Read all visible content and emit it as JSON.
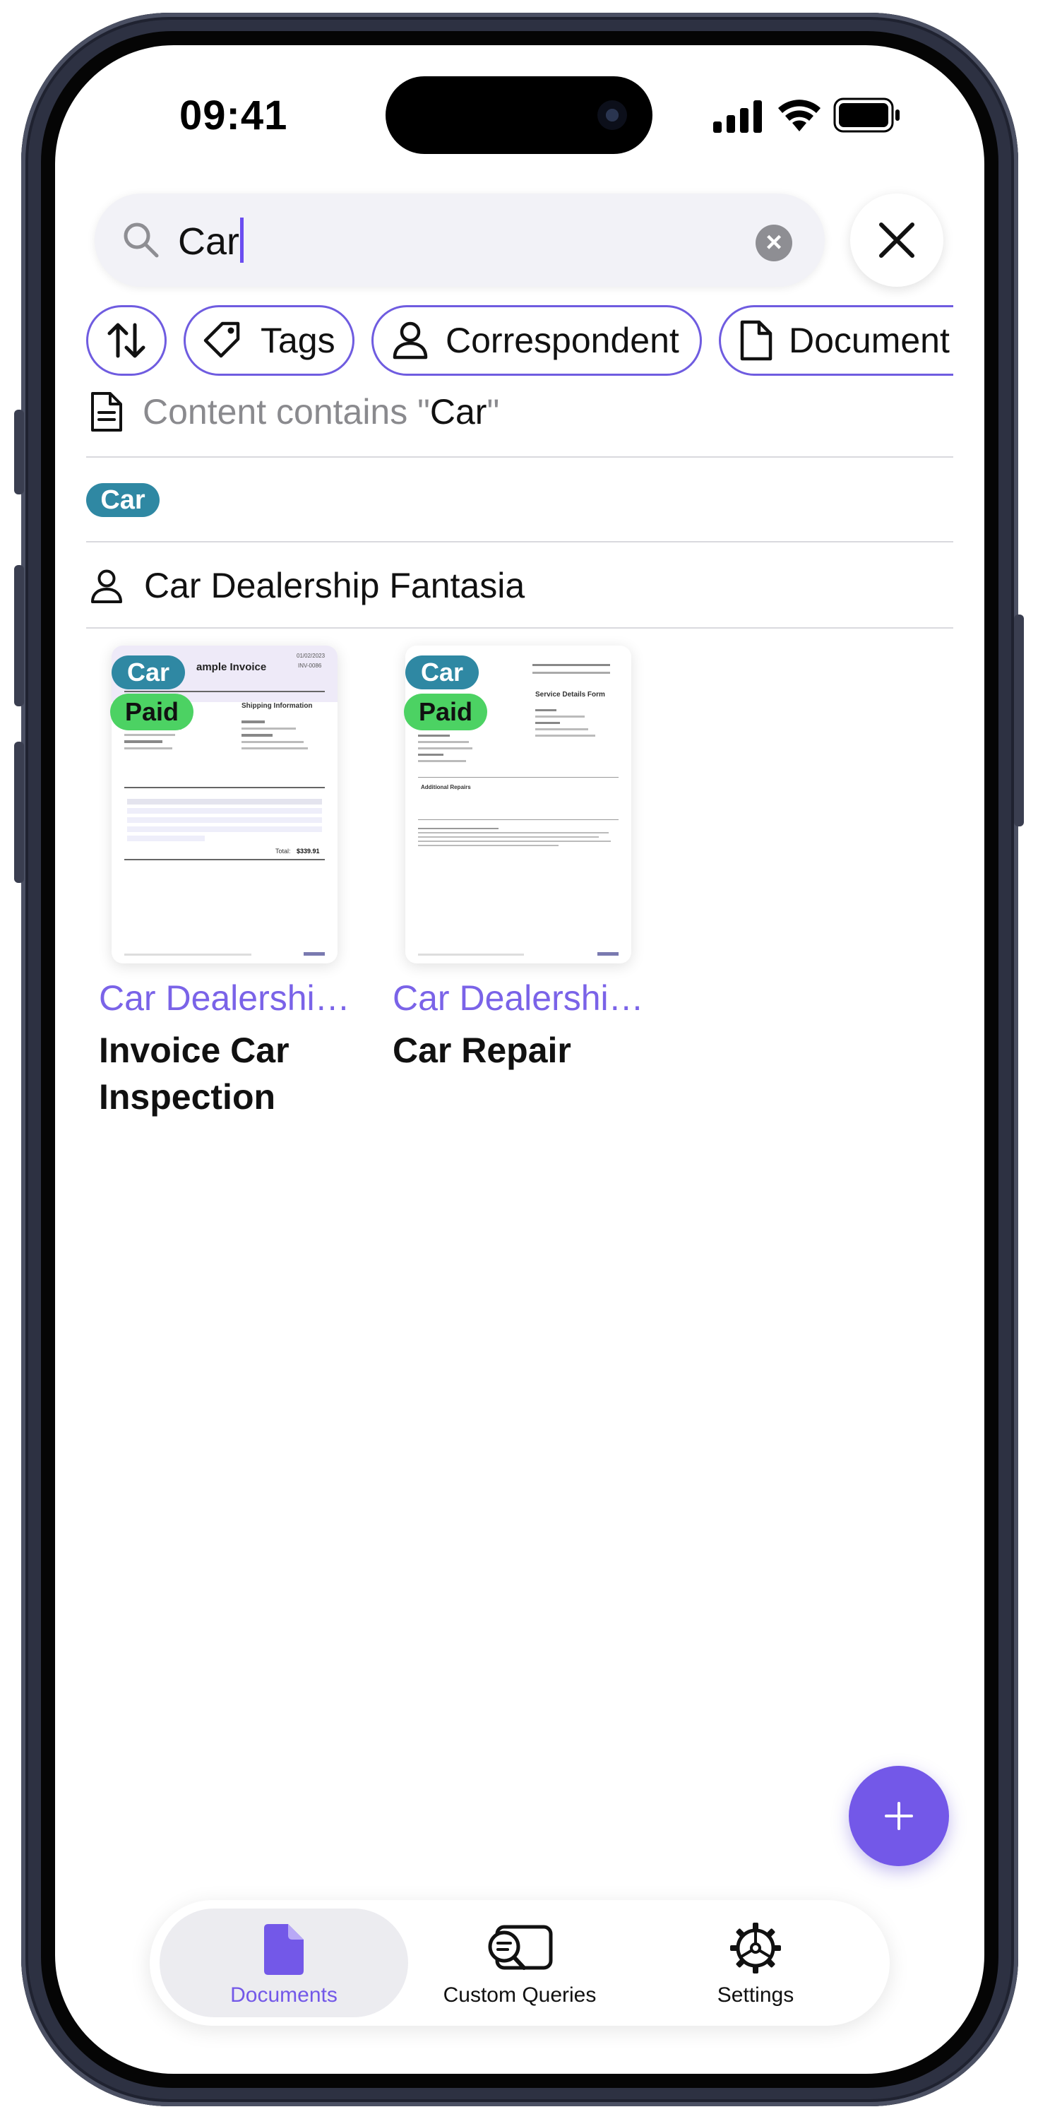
{
  "status_bar": {
    "time": "09:41"
  },
  "search": {
    "query": "Car"
  },
  "filters": [
    {
      "label": "",
      "icon": "sort-icon"
    },
    {
      "label": "Tags",
      "icon": "tag-icon"
    },
    {
      "label": "Correspondent",
      "icon": "person-icon"
    },
    {
      "label": "Document",
      "icon": "document-icon"
    }
  ],
  "suggestions": {
    "content_prefix": "Content contains \"",
    "content_query": "Car",
    "content_suffix": "\"",
    "tag_label": "Car",
    "correspondent": "Car Dealership Fantasia"
  },
  "documents": [
    {
      "correspondent": "Car Dealershi…",
      "title": "Invoice Car Inspection",
      "tags": [
        "Car",
        "Paid"
      ],
      "preview": {
        "heading": "ample Invoice",
        "date": "01/02/2023",
        "number": "INV-0086",
        "section": "Shipping Information",
        "total_label": "Total:",
        "total": "$339.91"
      }
    },
    {
      "correspondent": "Car Dealershi…",
      "title": "Car Repair",
      "tags": [
        "Car",
        "Paid"
      ],
      "preview": {
        "heading": "Service Details Form",
        "section": "Additional Repairs"
      }
    }
  ],
  "fab": {
    "label": "+"
  },
  "tabs": [
    {
      "label": "Documents",
      "icon": "document-filled-icon",
      "active": true
    },
    {
      "label": "Custom Queries",
      "icon": "search-message-icon",
      "active": false
    },
    {
      "label": "Settings",
      "icon": "gear-icon",
      "active": false
    }
  ],
  "colors": {
    "accent": "#7358e8",
    "tag_car": "#2f88a3",
    "tag_paid": "#4cd263",
    "chip_border": "#6f5ce0"
  }
}
